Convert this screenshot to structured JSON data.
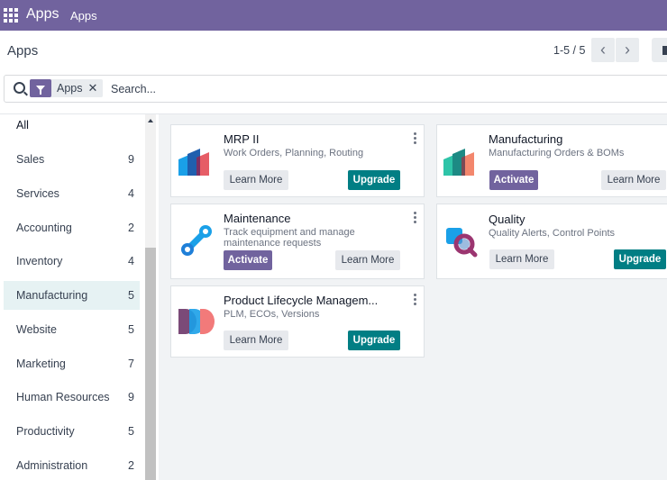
{
  "topbar": {
    "title": "Apps",
    "menu": "Apps"
  },
  "control_panel": {
    "breadcrumb": "Apps",
    "pager": "1-5 / 5"
  },
  "search": {
    "facet_label": "Apps",
    "placeholder": "Search..."
  },
  "sidebar": {
    "items": [
      {
        "label": "All",
        "count": ""
      },
      {
        "label": "Sales",
        "count": "9"
      },
      {
        "label": "Services",
        "count": "4"
      },
      {
        "label": "Accounting",
        "count": "2"
      },
      {
        "label": "Inventory",
        "count": "4"
      },
      {
        "label": "Manufacturing",
        "count": "5"
      },
      {
        "label": "Website",
        "count": "5"
      },
      {
        "label": "Marketing",
        "count": "7"
      },
      {
        "label": "Human Resources",
        "count": "9"
      },
      {
        "label": "Productivity",
        "count": "5"
      },
      {
        "label": "Administration",
        "count": "2"
      }
    ],
    "active": "Manufacturing"
  },
  "apps": [
    {
      "name": "MRP II",
      "summary": "Work Orders, Planning, Routing",
      "primary": "Learn More",
      "secondary": "Upgrade",
      "icon": "mrp-ii-icon"
    },
    {
      "name": "Manufacturing",
      "summary": "Manufacturing Orders & BOMs",
      "primary": "Activate",
      "secondary": "Learn More",
      "icon": "manufacturing-icon"
    },
    {
      "name": "Maintenance",
      "summary": "Track equipment and manage maintenance requests",
      "primary": "Activate",
      "secondary": "Learn More",
      "icon": "maintenance-icon"
    },
    {
      "name": "Quality",
      "summary": "Quality Alerts, Control Points",
      "primary": "Learn More",
      "secondary": "Upgrade",
      "icon": "quality-icon"
    },
    {
      "name": "Product Lifecycle Managem...",
      "summary": "PLM, ECOs, Versions",
      "primary": "Learn More",
      "secondary": "Upgrade",
      "icon": "plm-icon"
    }
  ],
  "colors": {
    "brand": "#71639e",
    "teal": "#017e84",
    "active_bg": "#e6f2f3"
  }
}
